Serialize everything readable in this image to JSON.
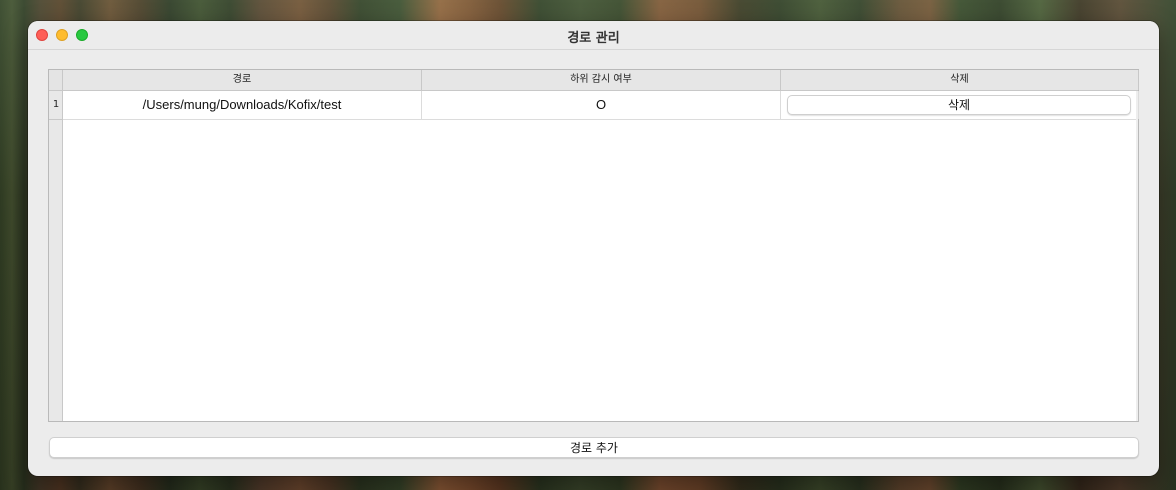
{
  "window": {
    "title": "경로 관리"
  },
  "table": {
    "columns": [
      "경로",
      "하위 감시 여부",
      "삭제"
    ],
    "rows": [
      {
        "number": "1",
        "path": "/Users/mung/Downloads/Kofix/test",
        "watch_subfolders": "O",
        "delete_label": "삭제"
      }
    ]
  },
  "footer": {
    "add_path_label": "경로 추가"
  },
  "colors": {
    "close": "#fe5f57",
    "minimize": "#febc2e",
    "maximize": "#28c840",
    "window_bg": "#ececec",
    "table_bg": "#ffffff"
  },
  "icons": {
    "close": "close-icon",
    "minimize": "minimize-icon",
    "maximize": "maximize-icon"
  }
}
